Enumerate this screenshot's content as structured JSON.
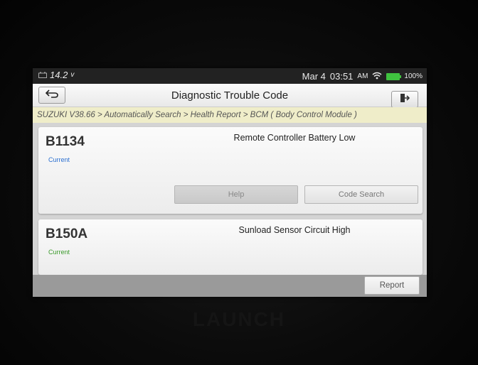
{
  "status_bar": {
    "voltage": "14.2",
    "voltage_unit": "v",
    "date": "Mar 4",
    "time": "03:51",
    "ampm": "AM",
    "battery": "100%"
  },
  "header": {
    "title": "Diagnostic Trouble Code"
  },
  "breadcrumb": "SUZUKI V38.66 > Automatically Search > Health Report > BCM ( Body Control Module )",
  "dtcs": [
    {
      "code": "B1134",
      "status": "Current",
      "status_color": "#2a6fd0",
      "description": "Remote Controller Battery Low",
      "actions": [
        "Help",
        "Code Search"
      ]
    },
    {
      "code": "B150A",
      "status": "Current",
      "status_color": "#3a9a2a",
      "description": "Sunload Sensor Circuit High"
    }
  ],
  "footer": {
    "report_label": "Report"
  },
  "device_brand": "LAUNCH",
  "icons": {
    "back": "back-arrow-icon",
    "exit": "exit-icon",
    "wifi": "wifi-icon",
    "battery": "battery-icon",
    "vehicle": "car-battery-icon"
  }
}
